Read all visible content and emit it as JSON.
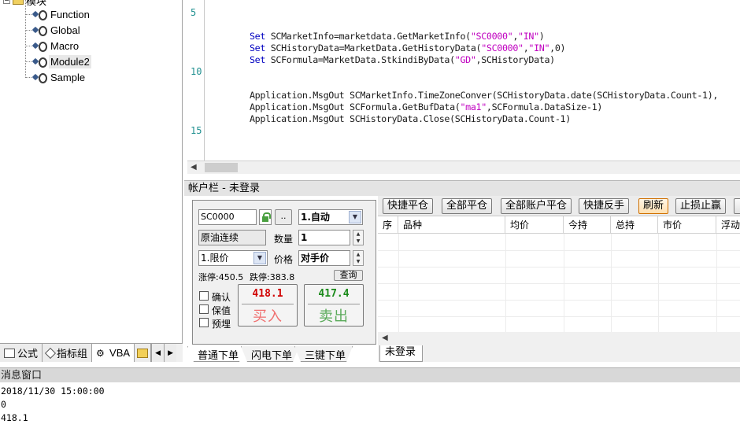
{
  "tree": {
    "root_label": "模块",
    "items": [
      "Function",
      "Global",
      "Macro",
      "Module2",
      "Sample"
    ],
    "selected": "Module2"
  },
  "left_tabs": [
    {
      "label": "公式",
      "icon": "formula-icon"
    },
    {
      "label": "指标组",
      "icon": "indicator-group-icon"
    },
    {
      "label": "VBA",
      "icon": "vba-icon"
    },
    {
      "label": "",
      "icon": "folder-icon"
    }
  ],
  "editor": {
    "line_numbers": [
      "5",
      "10",
      "15"
    ],
    "lines": [
      {
        "kw": "Set",
        "text": " SCMarketInfo=marketdata.GetMarketInfo(",
        "s1": "\"SC0000\"",
        "mid": ",",
        "s2": "\"IN\"",
        "tail": ")"
      },
      {
        "kw": "Set",
        "text": " SCHistoryData=MarketData.GetHistoryData(",
        "s1": "\"SC0000\"",
        "mid": ",",
        "s2": "\"IN\"",
        "tail": ",0)"
      },
      {
        "kw": "Set",
        "text": " SCFormula=MarketData.StkindiByData(",
        "s1": "\"GD\"",
        "mid": "",
        "s2": "",
        "tail": ",SCHistoryData)"
      },
      {
        "kw": "",
        "text": "Application.MsgOut SCMarketInfo.TimeZoneConver(SCHistoryData.date(SCHistoryData.Count-1),",
        "s1": "",
        "mid": "",
        "s2": "",
        "tail": ""
      },
      {
        "kw": "",
        "text": "Application.MsgOut SCFormula.GetBufData(",
        "s1": "\"ma1\"",
        "mid": "",
        "s2": "",
        "tail": ",SCFormula.DataSize-1)"
      },
      {
        "kw": "",
        "text": "Application.MsgOut SCHistoryData.Close(SCHistoryData.Count-1)",
        "s1": "",
        "mid": "",
        "s2": "",
        "tail": ""
      }
    ]
  },
  "account": {
    "title": "帐户栏 - 未登录"
  },
  "order": {
    "contract_code": "SC0000",
    "lock_btn": "",
    "more_btn": "..",
    "mode": "1.自动",
    "contract_name": "原油连续",
    "qty_label": "数量",
    "qty_value": "1",
    "order_type": "1.限价",
    "price_label": "价格",
    "price_value": "对手价",
    "limit_up": "涨停:450.5",
    "limit_down": "跌停:383.8",
    "query_btn": "查询",
    "checkboxes": [
      "确认",
      "保值",
      "预埋"
    ],
    "buy_price": "418.1",
    "buy_label": "买入",
    "sell_price": "417.4",
    "sell_label": "卖出",
    "buy_color": "#d00000",
    "sell_color": "#1a8a1a"
  },
  "order_tabs": [
    "普通下单",
    "闪电下单",
    "三键下单"
  ],
  "positions": {
    "toolbar": [
      "快捷平仓",
      "全部平仓",
      "全部账户平仓",
      "快捷反手",
      "刷新",
      "止损止赢"
    ],
    "columns": [
      "序",
      "品种",
      "均价",
      "今持",
      "总持",
      "市价",
      "浮动"
    ],
    "tab": "未登录"
  },
  "messages": {
    "title": "消息窗口",
    "lines": [
      "2018/11/30 15:00:00",
      "0",
      "418.1"
    ]
  }
}
